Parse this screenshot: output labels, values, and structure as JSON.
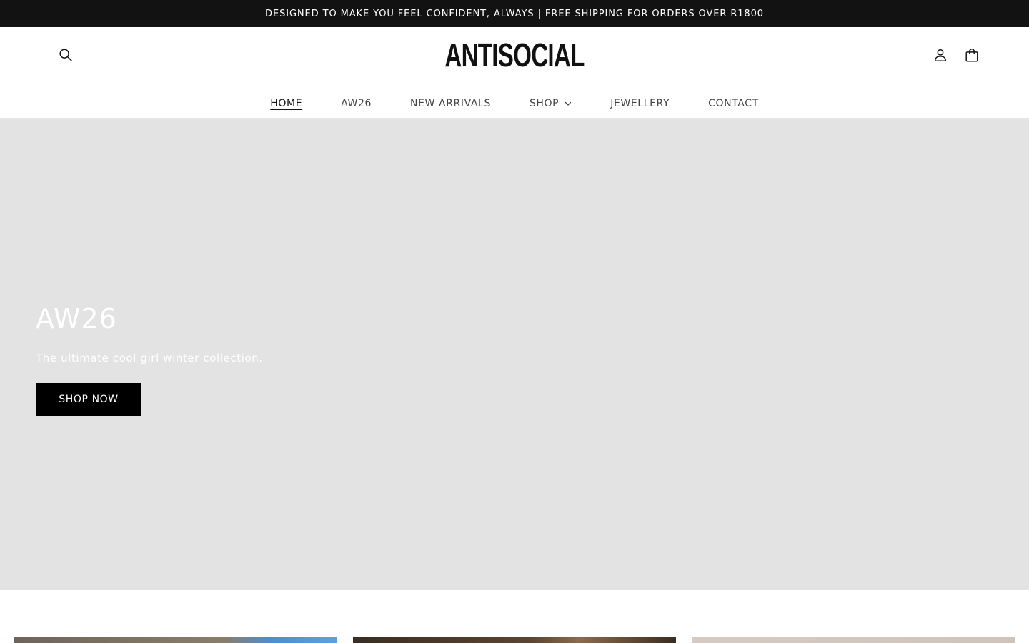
{
  "announcement": {
    "text": "DESIGNED TO MAKE YOU FEEL CONFIDENT, ALWAYS | FREE SHIPPING FOR ORDERS OVER R1800"
  },
  "header": {
    "logo": "ANTISOCIAL",
    "icons": {
      "search": "search-icon",
      "account": "account-icon",
      "cart": "cart-icon"
    }
  },
  "nav": {
    "items": [
      {
        "label": "HOME",
        "active": true
      },
      {
        "label": "AW26"
      },
      {
        "label": "NEW ARRIVALS"
      },
      {
        "label": "SHOP",
        "has_dropdown": true
      },
      {
        "label": "JEWELLERY"
      },
      {
        "label": "CONTACT"
      }
    ]
  },
  "hero": {
    "title": "AW26",
    "subtitle": "The ultimate cool girl winter collection.",
    "button_label": "SHOP NOW"
  },
  "colors": {
    "announcement_bg": "#121212",
    "hero_bg": "#e3e3e3",
    "button_bg": "#000000"
  }
}
